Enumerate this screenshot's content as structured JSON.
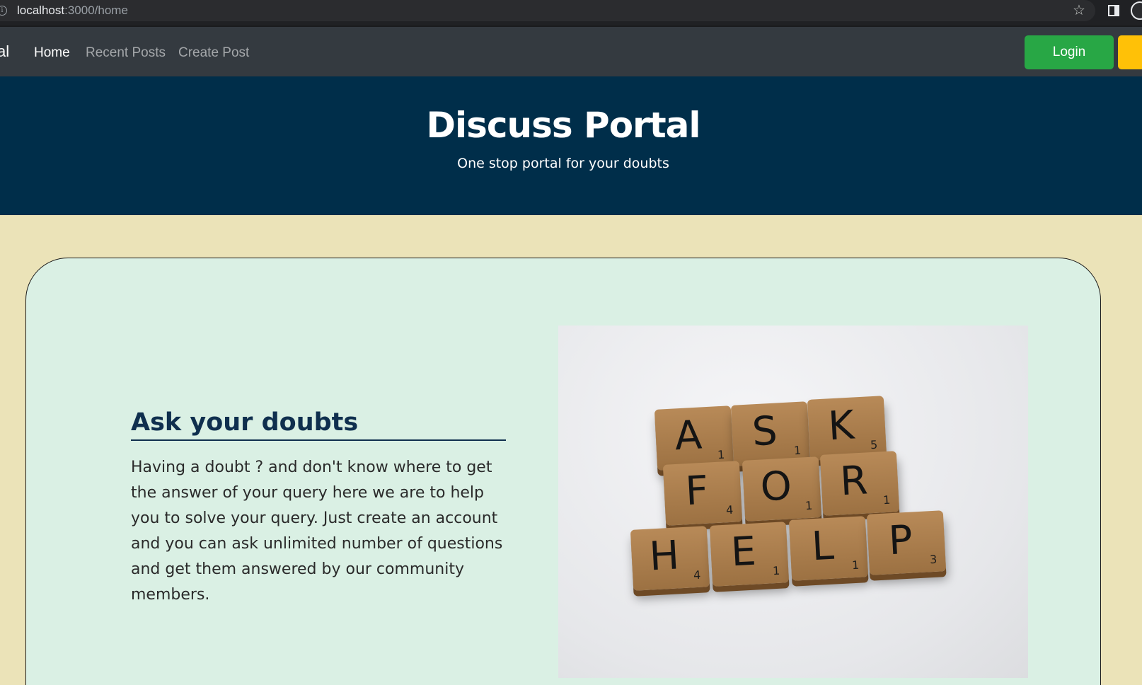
{
  "browser": {
    "url_host": "localhost",
    "url_path": ":3000/home",
    "icons": [
      "info-icon",
      "star-icon",
      "side-panel-icon",
      "profile-icon"
    ]
  },
  "navbar": {
    "brand": "al",
    "links": [
      {
        "label": "Home",
        "active": true
      },
      {
        "label": "Recent Posts",
        "active": false
      },
      {
        "label": "Create Post",
        "active": false
      }
    ],
    "login_label": "Login",
    "colors": {
      "bg": "#343a40",
      "login": "#28a745",
      "signup": "#ffc107"
    }
  },
  "hero": {
    "title": "Discuss Portal",
    "subtitle": "One stop portal for your doubts",
    "bg_color": "#002e4a"
  },
  "feature": {
    "title": "Ask your doubts",
    "body": "Having a doubt ? and don't know where to get the answer of your query here we are to help you to solve your query. Just create an account and you can ask unlimited number of questions and get them answered by our community members.",
    "image": {
      "tiles": [
        {
          "letter": "A",
          "score": "1"
        },
        {
          "letter": "S",
          "score": "1"
        },
        {
          "letter": "K",
          "score": "5"
        },
        {
          "letter": "F",
          "score": "4"
        },
        {
          "letter": "O",
          "score": "1"
        },
        {
          "letter": "R",
          "score": "1"
        },
        {
          "letter": "H",
          "score": "4"
        },
        {
          "letter": "E",
          "score": "1"
        },
        {
          "letter": "L",
          "score": "1"
        },
        {
          "letter": "P",
          "score": "3"
        }
      ]
    }
  },
  "colors": {
    "page_bg": "#ebe3b8",
    "card_bg": "#daf0e4"
  }
}
